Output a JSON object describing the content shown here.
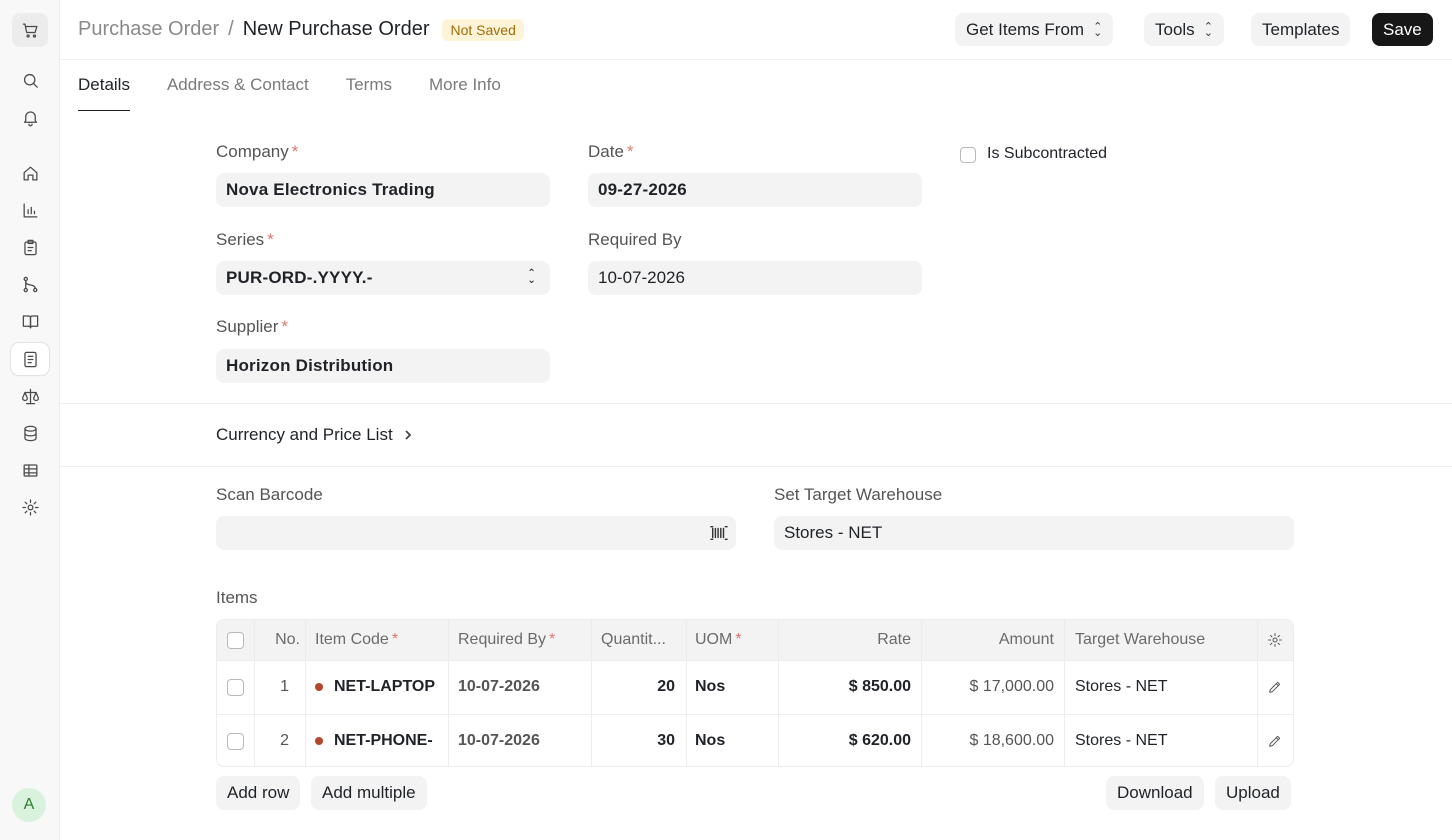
{
  "sidebar": {
    "items": [
      {
        "icon": "cart-icon"
      },
      {
        "icon": "search-icon"
      },
      {
        "icon": "bell-icon"
      },
      {
        "icon": "home-icon"
      },
      {
        "icon": "chart-icon"
      },
      {
        "icon": "clipboard-icon"
      },
      {
        "icon": "git-branch-icon"
      },
      {
        "icon": "book-icon"
      },
      {
        "icon": "document-icon"
      },
      {
        "icon": "scale-icon"
      },
      {
        "icon": "database-icon"
      },
      {
        "icon": "table-icon"
      },
      {
        "icon": "gear-icon"
      }
    ],
    "avatar_initial": "A"
  },
  "header": {
    "breadcrumb_parent": "Purchase Order",
    "breadcrumb_sep": "/",
    "title": "New Purchase Order",
    "status_badge": "Not Saved",
    "get_items_label": "Get Items From",
    "tools_label": "Tools",
    "templates_label": "Templates",
    "save_label": "Save"
  },
  "tabs": [
    {
      "label": "Details",
      "active": true
    },
    {
      "label": "Address & Contact",
      "active": false
    },
    {
      "label": "Terms",
      "active": false
    },
    {
      "label": "More Info",
      "active": false
    }
  ],
  "form": {
    "company": {
      "label": "Company",
      "required": "*",
      "value": "Nova Electronics Trading"
    },
    "date": {
      "label": "Date",
      "required": "*",
      "value": "09-27-2026"
    },
    "is_subcontracted": {
      "label": "Is Subcontracted"
    },
    "series": {
      "label": "Series",
      "required": "*",
      "value": "PUR-ORD-.YYYY.-"
    },
    "required_by": {
      "label": "Required By",
      "value": "10-07-2026"
    },
    "supplier": {
      "label": "Supplier",
      "required": "*",
      "value": "Horizon Distribution"
    }
  },
  "currency_section": {
    "title": "Currency and Price List"
  },
  "scan_barcode": {
    "label": "Scan Barcode",
    "value": ""
  },
  "target_warehouse": {
    "label": "Set Target Warehouse",
    "value": "Stores - NET"
  },
  "items": {
    "label": "Items",
    "columns": {
      "no": "No.",
      "item_code": "Item Code",
      "required_by": "Required By",
      "quantity": "Quantit...",
      "uom": "UOM",
      "rate": "Rate",
      "amount": "Amount",
      "target_warehouse": "Target Warehouse",
      "required_mark": "*"
    },
    "rows": [
      {
        "no": "1",
        "item_code": "NET-LAPTOP",
        "required_by": "10-07-2026",
        "quantity": "20",
        "uom": "Nos",
        "rate": "$ 850.00",
        "amount": "$ 17,000.00",
        "warehouse": "Stores - NET"
      },
      {
        "no": "2",
        "item_code": "NET-PHONE-",
        "required_by": "10-07-2026",
        "quantity": "30",
        "uom": "Nos",
        "rate": "$ 620.00",
        "amount": "$ 18,600.00",
        "warehouse": "Stores - NET"
      }
    ],
    "add_row_label": "Add row",
    "add_multiple_label": "Add multiple",
    "download_label": "Download",
    "upload_label": "Upload"
  }
}
